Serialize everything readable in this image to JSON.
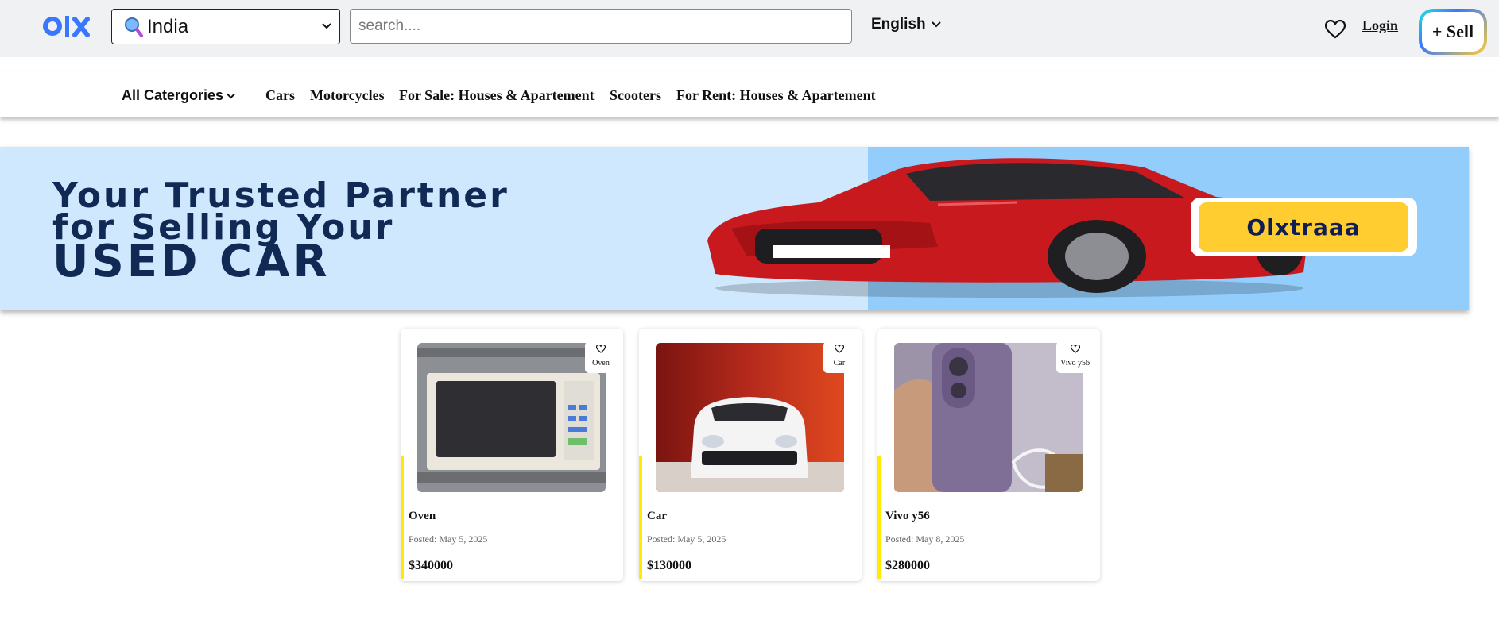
{
  "header": {
    "location_value": "India",
    "search_placeholder": "search....",
    "language": "English",
    "login_label": "Login",
    "sell_label": "+ Sell"
  },
  "categories": {
    "all_label": "All Catergories",
    "items": [
      "Cars",
      "Motorcycles",
      "For Sale: Houses & Apartement",
      "Scooters",
      "For Rent: Houses & Apartement"
    ]
  },
  "banner": {
    "line1": "Your Trusted Partner",
    "line2": "for Selling Your",
    "line3": "USED CAR",
    "brand": "Olxtraaa"
  },
  "listings": [
    {
      "title": "Oven",
      "tag": "Oven",
      "posted": "Posted: May 5, 2025",
      "price": "$340000"
    },
    {
      "title": "Car",
      "tag": "Car",
      "posted": "Posted: May 5, 2025",
      "price": "$130000"
    },
    {
      "title": "Vivo y56",
      "tag": "Vivo y56",
      "posted": "Posted: May 8, 2025",
      "price": "$280000"
    }
  ],
  "colors": {
    "header_bg": "#eff1f3",
    "brand_blue": "#3a77ff",
    "accent_yellow": "#ffea00",
    "banner_bg": "#cfe8fd"
  },
  "icons": [
    "olx-logo",
    "search-glass-icon",
    "chevron-down-icon",
    "heart-icon"
  ]
}
